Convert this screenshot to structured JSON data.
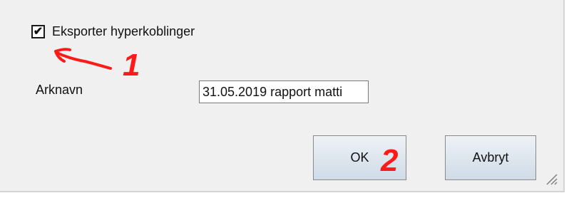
{
  "options": {
    "export_hyperlinks_label": "Eksporter hyperkoblinger",
    "export_hyperlinks_checked": true
  },
  "sheet_name": {
    "label": "Arknavn",
    "value": "31.05.2019 rapport matti"
  },
  "buttons": {
    "ok_label": "OK",
    "cancel_label": "Avbryt"
  },
  "annotations": {
    "marker_1": "1",
    "marker_2": "2",
    "color": "#ff1a1a"
  }
}
